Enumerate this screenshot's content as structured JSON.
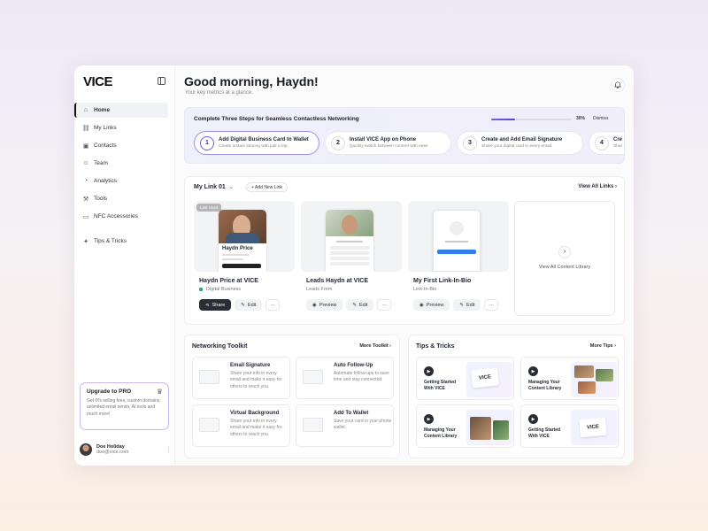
{
  "sidebar": {
    "logo": "VICE",
    "nav": [
      {
        "label": "Home",
        "icon": "home-icon",
        "active": true
      },
      {
        "label": "My Links",
        "icon": "link-icon"
      },
      {
        "label": "Contacts",
        "icon": "contacts-icon"
      },
      {
        "label": "Team",
        "icon": "team-icon"
      },
      {
        "label": "Analytics",
        "icon": "analytics-icon"
      },
      {
        "label": "Tools",
        "icon": "tools-icon"
      },
      {
        "label": "NFC  Accessories",
        "icon": "nfc-card-icon"
      },
      {
        "label": "Tips & Tricks",
        "icon": "lightbulb-icon"
      }
    ],
    "upgrade": {
      "title": "Upgrade to PRO",
      "desc": "Get 0% selling fees, custom domains, unlimited email sends, AI tools and much more!"
    },
    "user": {
      "name": "Doe Holiday",
      "email": "doe@vice.com"
    }
  },
  "header": {
    "greeting": "Good morning, Haydn!",
    "subtitle": "Your key metrics at a glance."
  },
  "steps": {
    "title": "Complete Three Steps for Seamless Contactless Networking",
    "progress_pct": 30,
    "progress_label": "30%",
    "dismiss": "Dismiss",
    "items": [
      {
        "num": "1",
        "title": "Add Digital Business Card to Wallet",
        "desc": "Create instant sharing with just a tap."
      },
      {
        "num": "2",
        "title": "Install VICE App on Phone",
        "desc": "Quickly switch between content with ease"
      },
      {
        "num": "3",
        "title": "Create and Add Email Signature",
        "desc": "Share your digital card in every email."
      },
      {
        "num": "4",
        "title": "Cre",
        "desc": "Shar"
      }
    ]
  },
  "links": {
    "title": "My Link 01",
    "add_new": "+ Add New Link",
    "view_all": "View All Links",
    "cards": [
      {
        "badge": "Last Used",
        "name": "Haydn Price at VICE",
        "type": "Digital Business",
        "primary": "Share",
        "secondary": "Edit",
        "phone_name": "Haydn Price"
      },
      {
        "name": "Leads Haydn at VICE",
        "type": "Leads Form",
        "primary": "Preview",
        "secondary": "Edit"
      },
      {
        "name": "My First Link-In-Bio",
        "type": "Link-In-Bio",
        "primary": "Preview",
        "secondary": "Edit"
      }
    ],
    "view_library": "View All Content Library",
    "more_btn": "···"
  },
  "toolkit": {
    "title": "Networking Toolkit",
    "more": "More Toolkit",
    "items": [
      {
        "title": "Email Signature",
        "desc": "Share your info in every email and make it easy for others to reach you."
      },
      {
        "title": "Auto Follow-Up",
        "desc": "Automate follow-ups to save time and stay connected."
      },
      {
        "title": "Virtual Background",
        "desc": "Share your info in every email and make it easy for others to reach you."
      },
      {
        "title": "Add To Wallet",
        "desc": "Save your card in your phone wallet."
      }
    ]
  },
  "tips": {
    "title": "Tips & Tricks",
    "more": "More Tips",
    "items": [
      {
        "title": "Getting Started With VICE"
      },
      {
        "title": "Managing Your Content Library"
      },
      {
        "title": "Managing Your Content Library"
      },
      {
        "title": "Getting Started With VICE"
      }
    ]
  },
  "icons": {
    "chevron": "›",
    "chevron_down": "⌄",
    "play": "▶",
    "bell": "🔔",
    "crown": "♛",
    "more": "⋮"
  },
  "colors": {
    "accent": "#6f5ce0",
    "dark_button": "#2a2d33",
    "status_green": "#3aa776"
  }
}
